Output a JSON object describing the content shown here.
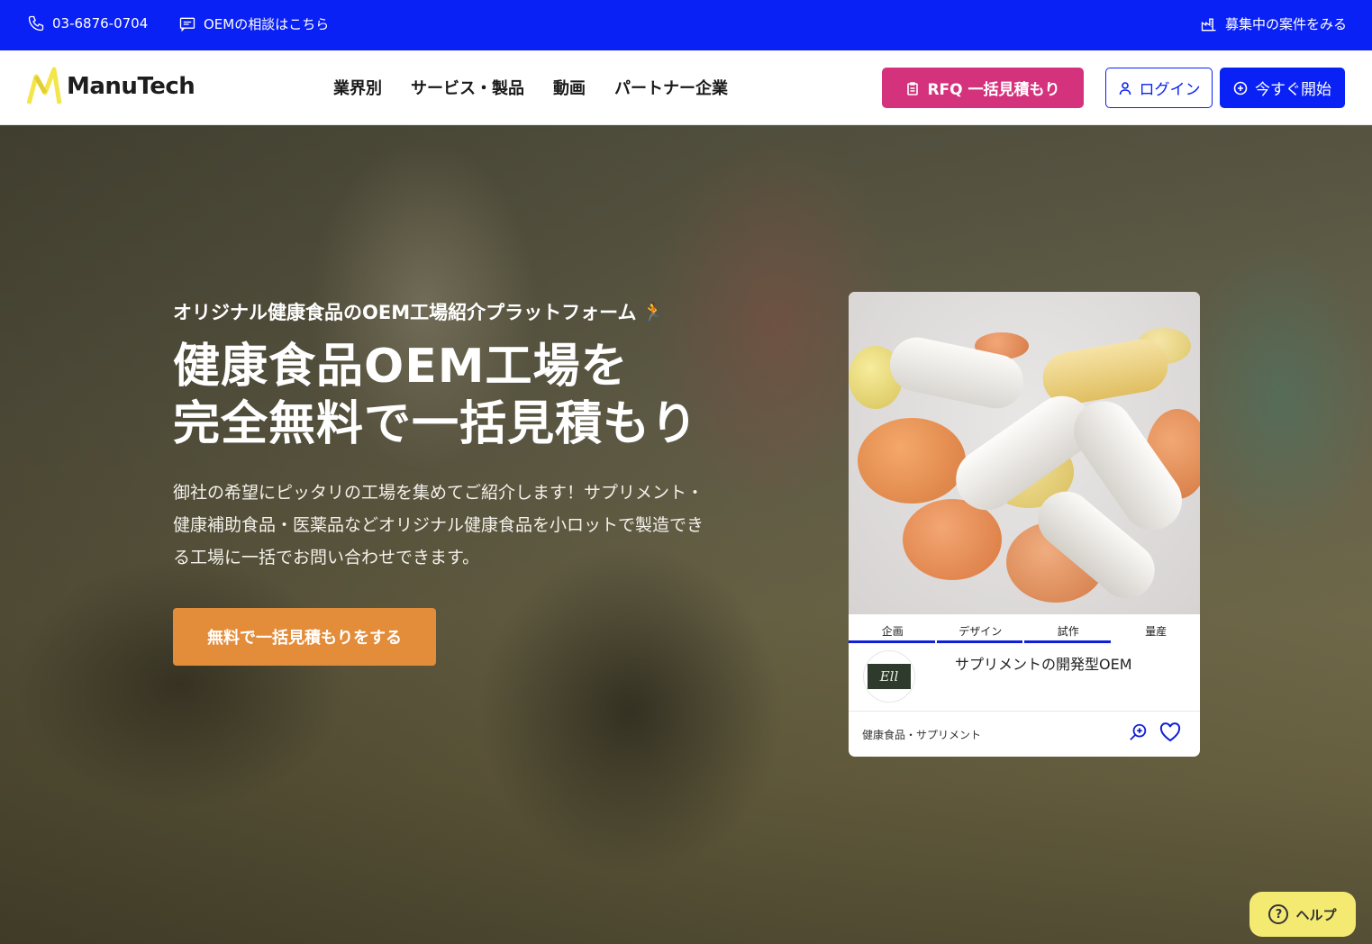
{
  "topbar": {
    "phone": "03-6876-0704",
    "consult": "OEMの相談はこちら",
    "cases": "募集中の案件をみる",
    "bg_color": "#0a21f5"
  },
  "header": {
    "logo_text": "ManuTech",
    "nav": [
      "業界別",
      "サービス・製品",
      "動画",
      "パートナー企業"
    ],
    "rfq_button": "RFQ 一括見積もり",
    "login_button": "ログイン",
    "start_button": "今すぐ開始",
    "rfq_color": "#d4327c",
    "primary_color": "#0a21f5"
  },
  "hero": {
    "eyebrow": "オリジナル健康食品のOEM工場紹介プラットフォーム",
    "eyebrow_emoji": "🏃",
    "headline_line1": "健康食品OEM工場を",
    "headline_line2": "完全無料で一括見積もり",
    "description": "御社の希望にピッタリの工場を集めてご紹介します！サプリメント・健康補助食品・医薬品などオリジナル健康食品を小ロットで製造できる工場に一括でお問い合わせできます。",
    "cta": "無料で一括見積もりをする",
    "cta_color": "#e38c3a"
  },
  "card": {
    "steps": [
      "企画",
      "デザイン",
      "試作",
      "量産"
    ],
    "active_steps": 3,
    "avatar_text": "Ell",
    "title": "サプリメントの開発型OEM",
    "tag": "健康食品・サプリメント",
    "icons": [
      "zoom-in-icon",
      "heart-icon"
    ]
  },
  "help": {
    "label": "ヘルプ",
    "icon": "question-icon"
  }
}
